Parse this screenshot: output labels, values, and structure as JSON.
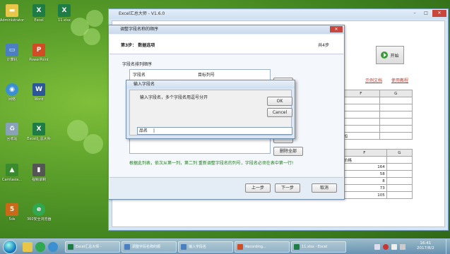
{
  "desktop": {
    "icons": [
      {
        "label": "Administrator",
        "color": "#e8c64a"
      },
      {
        "label": "Excel",
        "color": "#1e7d45"
      },
      {
        "label": "11.xlsx",
        "color": "#1e7d45"
      },
      {
        "label": "计算机",
        "color": "#4a7fc2"
      },
      {
        "label": "PowerPoint",
        "color": "#d14b24"
      },
      {
        "label": "网络",
        "color": "#3c8fd0"
      },
      {
        "label": "Word",
        "color": "#2b579a"
      },
      {
        "label": "回收站",
        "color": "#8aa2b8"
      },
      {
        "label": "Excel汇总大师",
        "color": "#1e7d45"
      },
      {
        "label": "Camtasia...",
        "color": "#3a8a2e"
      },
      {
        "label": "视频录制",
        "color": "#555555"
      },
      {
        "label": "5ds",
        "color": "#c96a18"
      },
      {
        "label": "360安全浏览器",
        "color": "#2fa84f"
      }
    ]
  },
  "main_window": {
    "title": "Excel汇总大师 - V1.6.0",
    "start_label": "开始",
    "link1": "示例文档",
    "link2": "使用教程",
    "grid1": {
      "cols": [
        "F",
        "G"
      ],
      "rows": [
        [
          "",
          ""
        ],
        [
          "",
          ""
        ],
        [
          "",
          ""
        ],
        [
          "",
          ""
        ],
        [
          "",
          ""
        ],
        [
          "瓜",
          ""
        ]
      ]
    },
    "grid2": {
      "cols": [
        "F",
        "G"
      ],
      "rows": [
        [
          "价格",
          ""
        ],
        [
          "164",
          ""
        ],
        [
          "58",
          ""
        ],
        [
          "8",
          ""
        ],
        [
          "73",
          ""
        ],
        [
          "105",
          ""
        ]
      ]
    }
  },
  "wizard": {
    "title": "调整字段名称的顺序",
    "step": "第3步：   数据选项",
    "step_total": "共4步",
    "section_label": "字段名排列顺序",
    "list_header_left": "字段名",
    "list_header_right": "目标列号",
    "delete_all": "删除全部",
    "hint": "根据此列表，依次从第一列，第二列   重新调整字段名的列号，字段名必须在表中第一行!",
    "prev": "上一步",
    "next": "下一步",
    "cancel": "取消"
  },
  "input_dialog": {
    "title": "输入字段名",
    "prompt": "输入字段名，多个字段名用逗号分开",
    "ok": "OK",
    "cancel": "Cancel",
    "value": "品名"
  },
  "taskbar": {
    "items": [
      {
        "label": "Excel汇总大师 -",
        "color": "#1e7d45"
      },
      {
        "label": "调整字段名称的顺",
        "color": "#4a7fc2"
      },
      {
        "label": "输入字段名",
        "color": "#4a7fc2"
      },
      {
        "label": "Recording...",
        "color": "#d14b24"
      },
      {
        "label": "11.xlsx - Excel",
        "color": "#1e7d45"
      }
    ],
    "clock_time": "16:41",
    "clock_date": "2017/8/2"
  }
}
